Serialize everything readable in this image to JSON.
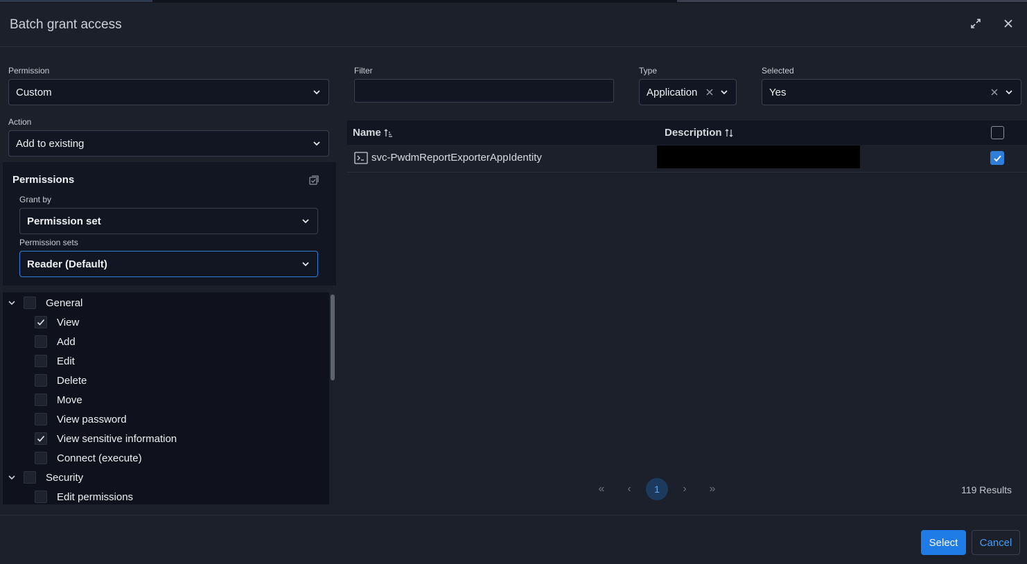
{
  "dialog": {
    "title": "Batch grant access"
  },
  "form": {
    "permission": {
      "label": "Permission",
      "value": "Custom"
    },
    "action": {
      "label": "Action",
      "value": "Add to existing"
    },
    "permissions_section": {
      "title": "Permissions",
      "grant_by": {
        "label": "Grant by",
        "value": "Permission set"
      },
      "permission_sets": {
        "label": "Permission sets",
        "value": "Reader (Default)"
      }
    }
  },
  "tree": {
    "groups": [
      {
        "label": "General",
        "checked": false,
        "items": [
          {
            "label": "View",
            "checked": true
          },
          {
            "label": "Add",
            "checked": false
          },
          {
            "label": "Edit",
            "checked": false
          },
          {
            "label": "Delete",
            "checked": false
          },
          {
            "label": "Move",
            "checked": false
          },
          {
            "label": "View password",
            "checked": false
          },
          {
            "label": "View sensitive information",
            "checked": true
          },
          {
            "label": "Connect (execute)",
            "checked": false
          }
        ]
      },
      {
        "label": "Security",
        "checked": false,
        "items": [
          {
            "label": "Edit permissions",
            "checked": false
          }
        ]
      }
    ]
  },
  "filters": {
    "filter": {
      "label": "Filter",
      "value": ""
    },
    "type": {
      "label": "Type",
      "value": "Application"
    },
    "selected": {
      "label": "Selected",
      "value": "Yes"
    }
  },
  "table": {
    "columns": [
      "Name",
      "Description"
    ],
    "rows": [
      {
        "name": "svc-PwdmReportExporterAppIdentity",
        "description_redacted": true,
        "checked": true
      }
    ]
  },
  "pagination": {
    "first": "«",
    "prev": "‹",
    "current": "1",
    "next": "›",
    "last": "»",
    "results": "119 Results"
  },
  "buttons": {
    "select": "Select",
    "cancel": "Cancel"
  },
  "colors": {
    "accent": "#1f7ce6",
    "background": "#1c202b",
    "panel": "#121622"
  }
}
